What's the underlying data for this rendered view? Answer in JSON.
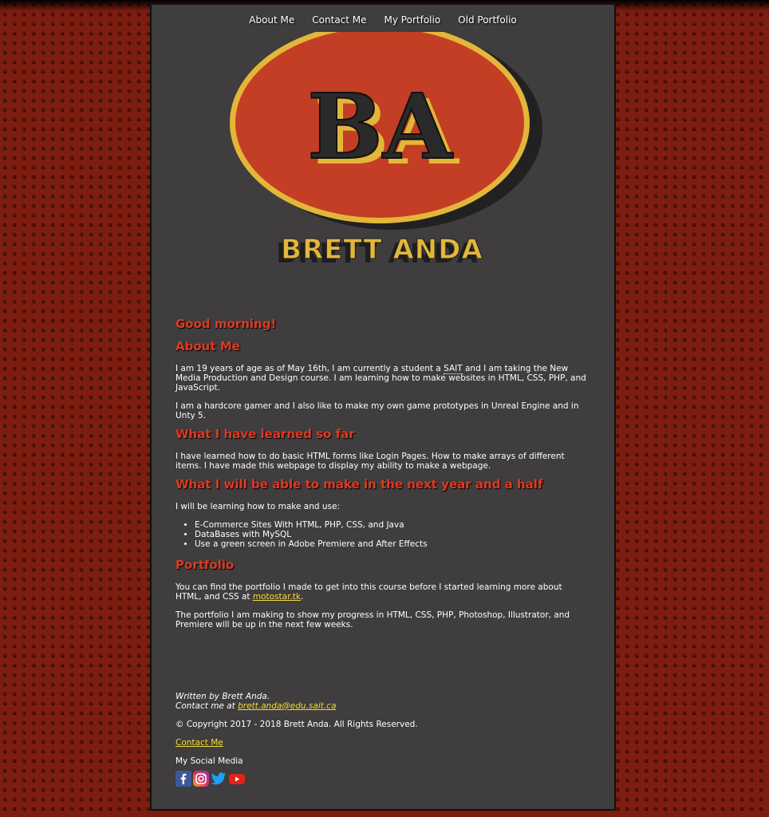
{
  "nav": {
    "items": [
      "About Me",
      "Contact Me",
      "My Portfolio",
      "Old Portfolio"
    ]
  },
  "logo": {
    "initials": "BA",
    "name": "BRETT ANDA"
  },
  "greeting": "Good morning!",
  "about": {
    "heading": "About Me",
    "p1_part1": "I am 19 years of age as of May 16th, I am currently a student a ",
    "p1_abbr": "SAIT",
    "p1_part2": " and I am taking the New Media Production and Design course. I am learning how to make websites in HTML, CSS, PHP, and JavaScript.",
    "p2": "I am a hardcore gamer and I also like to make my own game prototypes in Unreal Engine and in Unty 5."
  },
  "learned": {
    "heading": "What I have learned so far",
    "p1": "I have learned how to do basic HTML forms like Login Pages. How to make arrays of different items. I have made this webpage to display my ability to make a webpage."
  },
  "future": {
    "heading": "What I will be able to make in the next year and a half",
    "intro": "I will be learning how to make and use:",
    "items": [
      "E-Commerce Sites With HTML, PHP, CSS, and Java",
      "DataBases with MySQL",
      "Use a green screen in Adobe Premiere and After Effects"
    ]
  },
  "portfolio": {
    "heading": "Portfolio",
    "p1_part1": "You can find the portfolio I made to get into this course before I started learning more about HTML, and CSS at ",
    "p1_link": "motostar.tk",
    "p1_part2": ".",
    "p2": "The portfolio I am making to show my progress in HTML, CSS, PHP, Photoshop, Illustrator, and Premiere will be up in the next few weeks."
  },
  "footer": {
    "written_by": "Written by Brett Anda.",
    "contact_prefix": "Contact me at ",
    "email": "brett.anda@edu.sait.ca",
    "copyright": "© Copyright 2017 - 2018 Brett Anda. All Rights Reserved.",
    "contact_link": "Contact Me",
    "social_label": "My Social Media",
    "social_icons": [
      "facebook-icon",
      "instagram-icon",
      "twitter-icon",
      "youtube-icon"
    ]
  },
  "colors": {
    "background": "#7d1d10",
    "panel": "#3f3d3d",
    "heading": "#dc3b24",
    "link": "#f5dc3a",
    "logo_oval": "#c33e24",
    "logo_gold": "#e3b63a"
  }
}
